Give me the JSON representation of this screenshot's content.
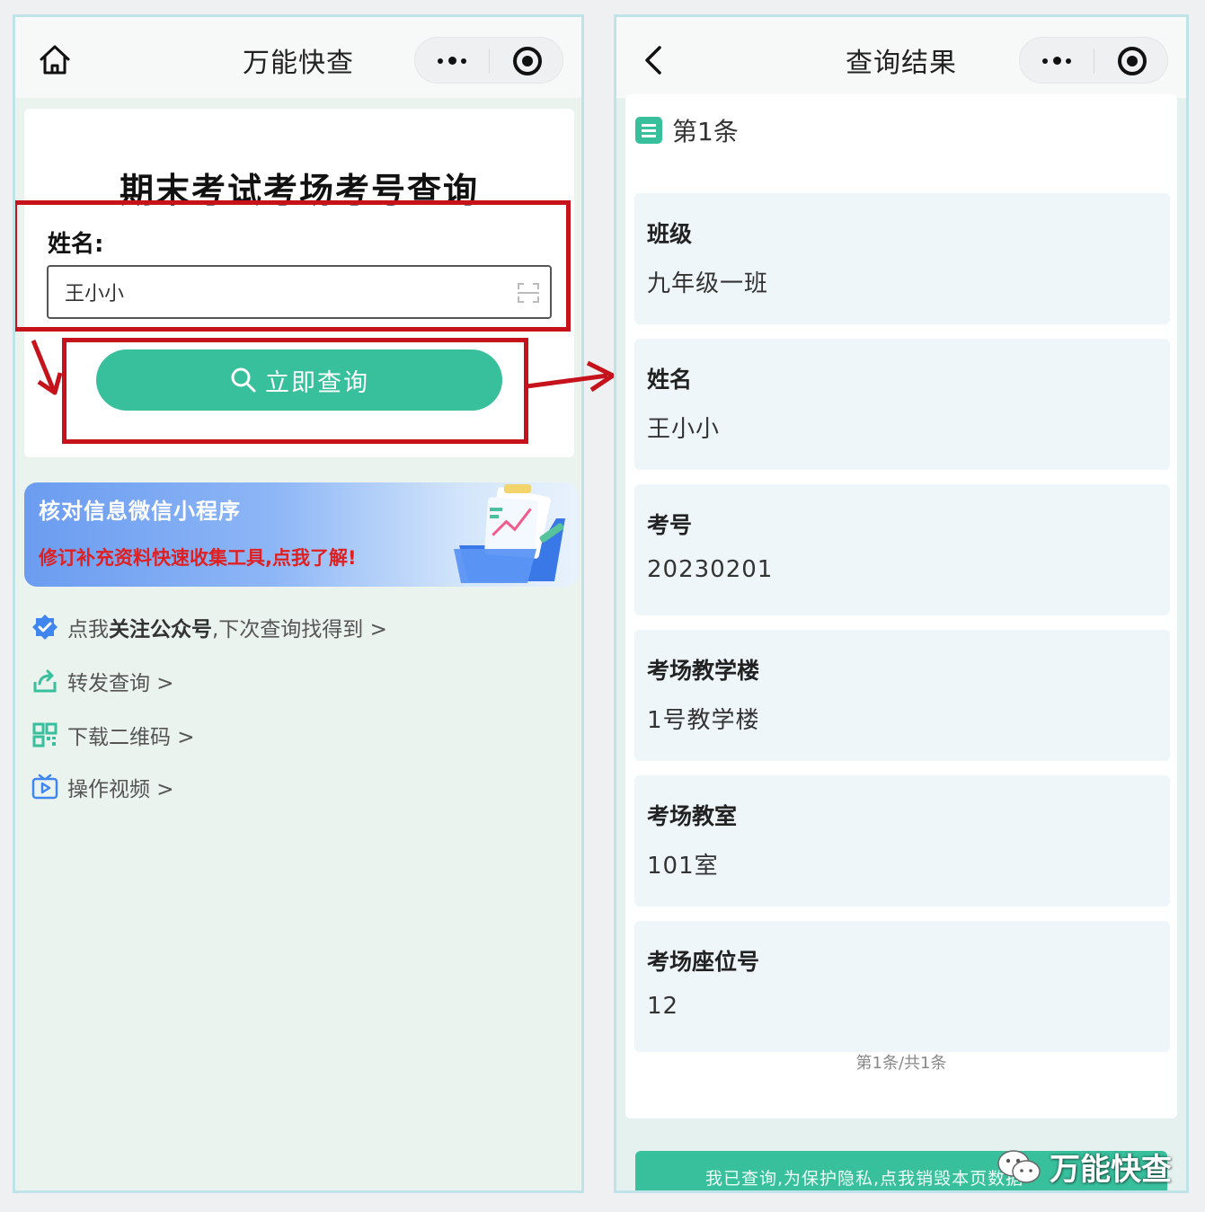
{
  "left_screen": {
    "nav_title": "万能快查",
    "form_title": "期末考试考场考号查询",
    "name_label": "姓名:",
    "name_value": "王小小",
    "query_button_label": "立即查询",
    "banner": {
      "title": "核对信息微信小程序",
      "subtitle": "修订补充资料快速收集工具,点我了解!"
    },
    "links": {
      "follow_prefix": "点我",
      "follow_bold": "关注公众号",
      "follow_suffix": ",下次查询找得到 >",
      "forward": "转发查询 >",
      "qrcode": "下载二维码 >",
      "video": "操作视频 >"
    },
    "icons": [
      "home-icon",
      "more-dots-icon",
      "close-circle-icon",
      "scan-icon",
      "search-icon",
      "verified-badge-icon",
      "share-icon",
      "qrcode-icon",
      "video-icon"
    ]
  },
  "right_screen": {
    "nav_title": "查询结果",
    "record_label": "第1条",
    "fields": [
      {
        "label": "班级",
        "value": "九年级一班"
      },
      {
        "label": "姓名",
        "value": "王小小"
      },
      {
        "label": "考号",
        "value": "20230201"
      },
      {
        "label": "考场教学楼",
        "value": "1号教学楼"
      },
      {
        "label": "考场教室",
        "value": "101室"
      },
      {
        "label": "考场座位号",
        "value": "12"
      }
    ],
    "pager": "第1条/共1条",
    "bottom_button": "我已查询,为保护隐私,点我销毁本页数据",
    "icons": [
      "back-icon",
      "more-dots-icon",
      "close-circle-icon",
      "list-icon"
    ]
  },
  "watermark": "万能快查",
  "colors": {
    "accent_green": "#38bf9c",
    "highlight_red": "#c5121b",
    "banner_red_text": "#e02020",
    "banner_blue": "#6b9cf0"
  }
}
